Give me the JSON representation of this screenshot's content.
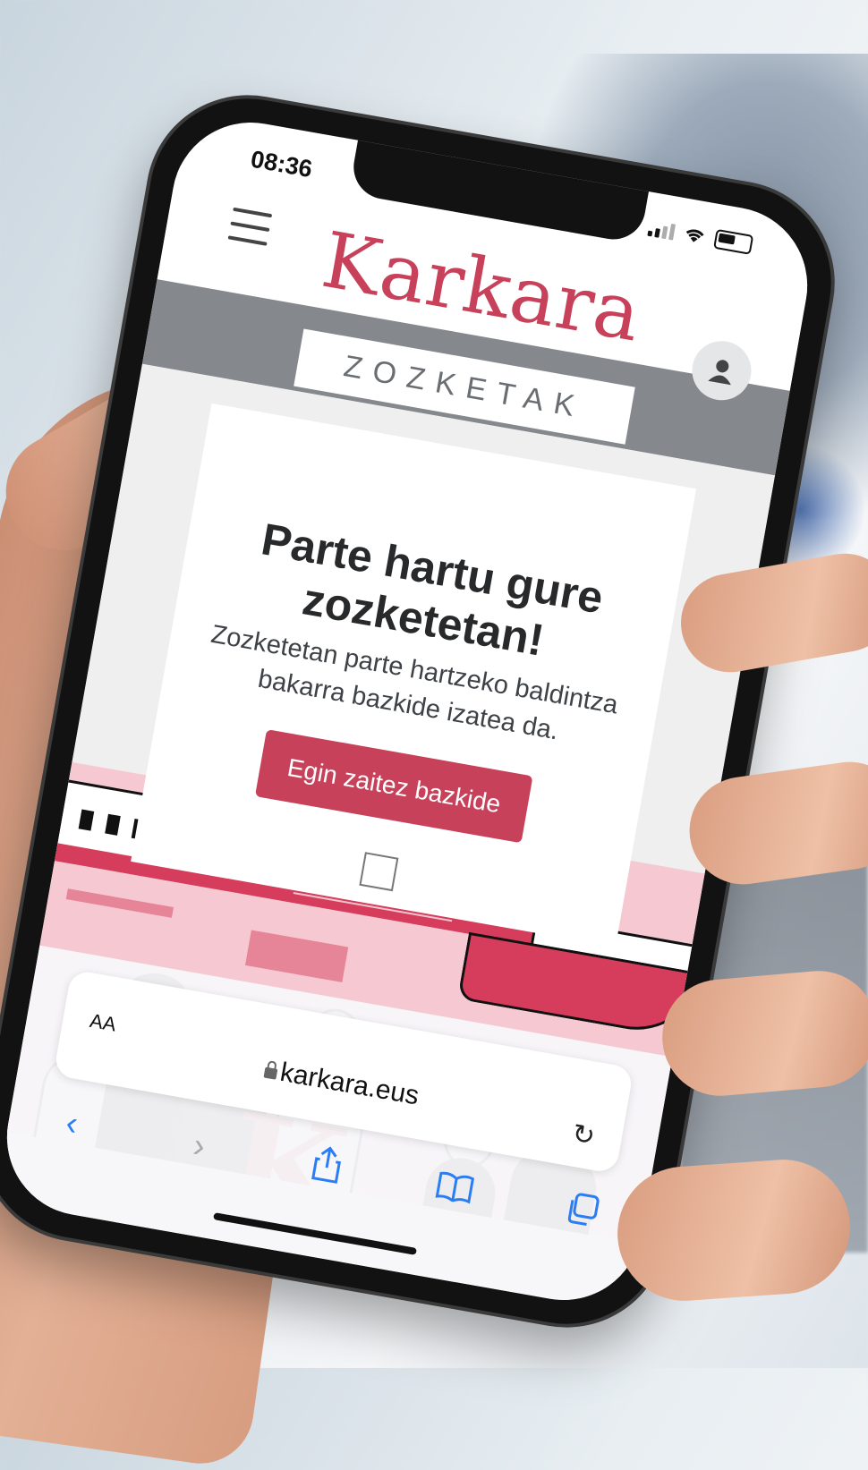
{
  "status_bar": {
    "time": "08:36",
    "location_icon": "location-arrow-icon",
    "signal_icon": "signal-icon",
    "wifi_icon": "wifi-icon",
    "battery_icon": "battery-icon"
  },
  "site": {
    "menu_icon": "hamburger-menu-icon",
    "logo": "Karkara",
    "section": "ZOZKETAK",
    "user_icon": "user-icon",
    "brand_color": "#c8415a",
    "band_color": "#85898d"
  },
  "card": {
    "title": "Parte hartu gure zozketetan!",
    "description": "Zozketetan parte hartzeko baldintza bakarra bazkide izatea da.",
    "button_label": "Egin zaitez bazkide"
  },
  "safari": {
    "text_size_label": "AA",
    "url": "karkara.eus",
    "lock_icon": "lock-icon",
    "reload_icon": "reload-icon",
    "toolbar": {
      "back": "‹",
      "forward": "›",
      "share": "⇧",
      "bookmarks": "📖",
      "tabs": "⧉"
    }
  }
}
